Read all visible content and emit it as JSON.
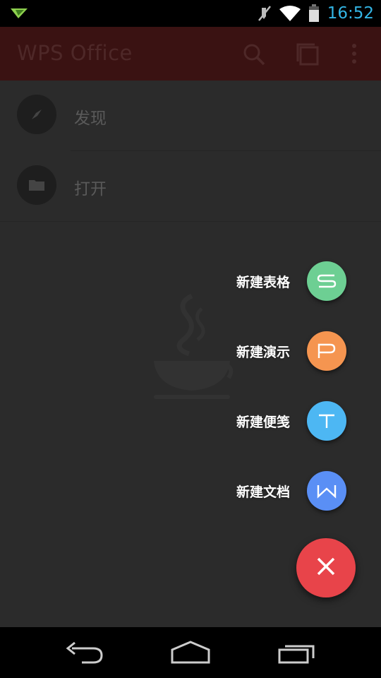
{
  "status_bar": {
    "time": "16:52",
    "icons": [
      "notification-plane-icon",
      "mute-icon",
      "wifi-icon",
      "battery-icon"
    ],
    "time_color": "#33b5e5"
  },
  "app_bar": {
    "title": "WPS Office",
    "actions": [
      "search-icon",
      "windows-icon",
      "overflow-menu-icon"
    ],
    "color": "#3a1212"
  },
  "list": {
    "items": [
      {
        "label": "发现",
        "icon": "compass-icon"
      },
      {
        "label": "打开",
        "icon": "folder-icon"
      }
    ]
  },
  "fab_menu": {
    "items": [
      {
        "label": "新建表格",
        "letter": "S",
        "color": "#6dcf93"
      },
      {
        "label": "新建演示",
        "letter": "P",
        "color": "#f59550"
      },
      {
        "label": "新建便笺",
        "letter": "T",
        "color": "#4db7f3"
      },
      {
        "label": "新建文档",
        "letter": "W",
        "color": "#5a8ff5"
      }
    ],
    "close_icon": "close-icon",
    "close_color": "#e8444a"
  },
  "nav_bar": {
    "buttons": [
      "back-icon",
      "home-icon",
      "recents-icon"
    ]
  }
}
